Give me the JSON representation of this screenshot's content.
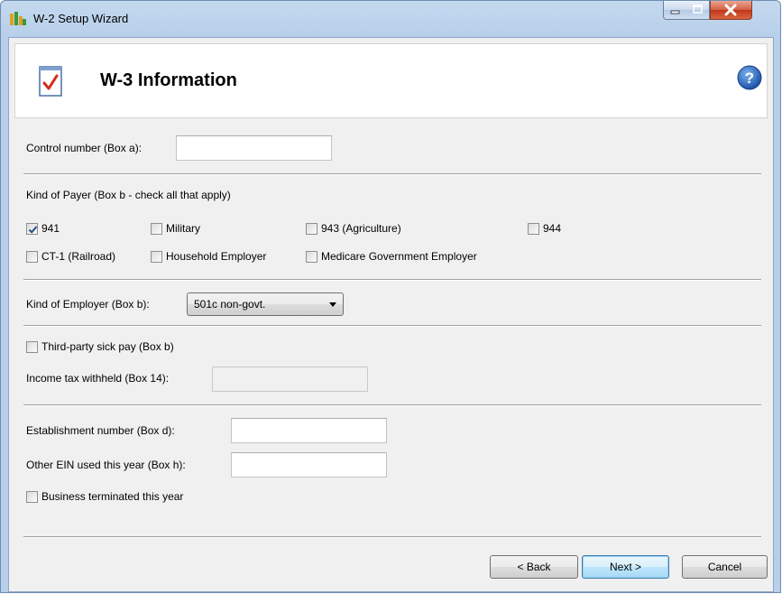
{
  "window": {
    "title": "W-2 Setup Wizard"
  },
  "header": {
    "title": "W-3 Information"
  },
  "control_number": {
    "label": "Control number (Box a):",
    "value": ""
  },
  "kind_of_payer": {
    "label": "Kind of Payer (Box b - check all that apply)",
    "options": [
      {
        "label": "941",
        "checked": true
      },
      {
        "label": "Military",
        "checked": false
      },
      {
        "label": "943 (Agriculture)",
        "checked": false
      },
      {
        "label": "944",
        "checked": false
      },
      {
        "label": "CT-1 (Railroad)",
        "checked": false
      },
      {
        "label": "Household Employer",
        "checked": false
      },
      {
        "label": "Medicare Government Employer",
        "checked": false
      }
    ]
  },
  "kind_of_employer": {
    "label": "Kind of Employer (Box b):",
    "selected": "501c non-govt."
  },
  "third_party_sick_pay": {
    "label": "Third-party sick pay (Box b)",
    "checked": false
  },
  "income_tax_withheld": {
    "label": "Income tax withheld (Box 14):",
    "value": ""
  },
  "establishment_number": {
    "label": "Establishment number (Box d):",
    "value": ""
  },
  "other_ein": {
    "label": "Other EIN used this year (Box h):",
    "value": ""
  },
  "business_terminated": {
    "label": "Business terminated this year",
    "checked": false
  },
  "buttons": {
    "back": "< Back",
    "next": "Next >",
    "cancel": "Cancel"
  }
}
